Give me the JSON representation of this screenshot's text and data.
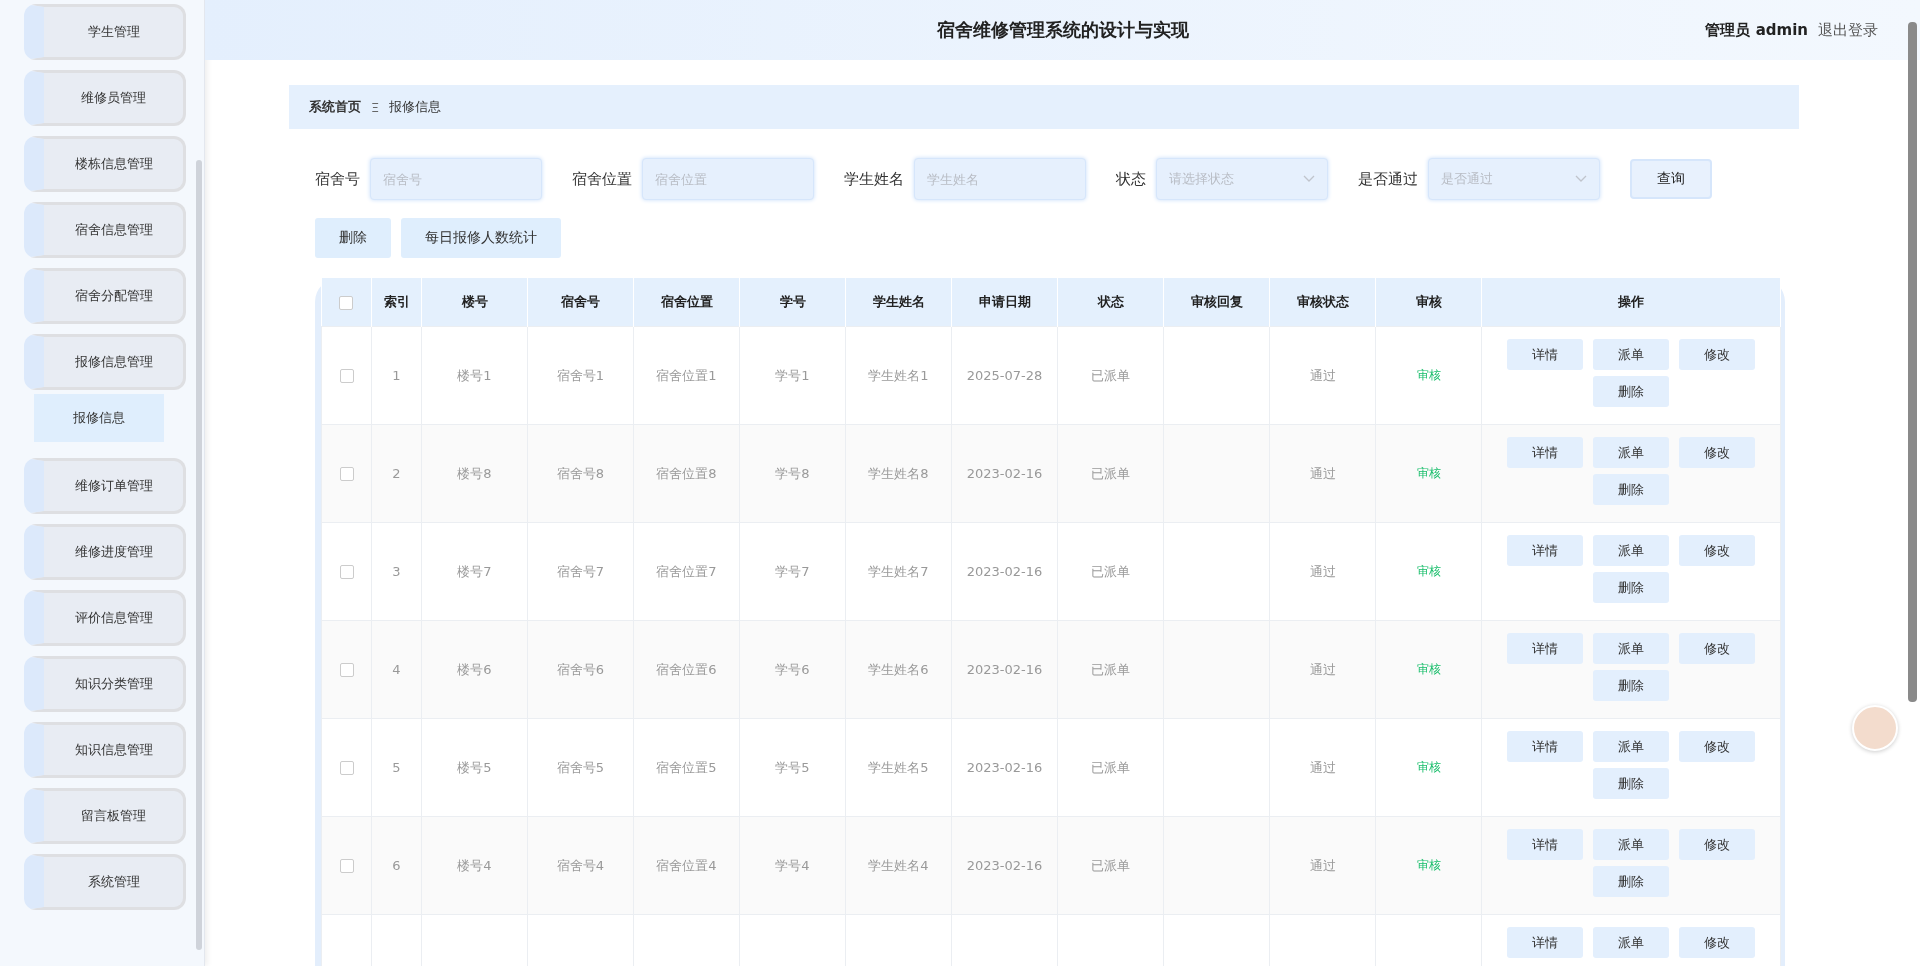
{
  "header": {
    "title": "宿舍维修管理系统的设计与实现",
    "user": "管理员 admin",
    "logout": "退出登录"
  },
  "sidebar": {
    "items": [
      {
        "label": "学生管理",
        "selected": false
      },
      {
        "label": "维修员管理",
        "selected": false
      },
      {
        "label": "楼栋信息管理",
        "selected": false
      },
      {
        "label": "宿舍信息管理",
        "selected": false
      },
      {
        "label": "宿舍分配管理",
        "selected": false
      },
      {
        "label": "报修信息管理",
        "selected": false,
        "expanded": true,
        "children": [
          {
            "label": "报修信息",
            "selected": true
          }
        ]
      },
      {
        "label": "维修订单管理",
        "selected": false
      },
      {
        "label": "维修进度管理",
        "selected": false
      },
      {
        "label": "评价信息管理",
        "selected": false
      },
      {
        "label": "知识分类管理",
        "selected": false
      },
      {
        "label": "知识信息管理",
        "selected": false
      },
      {
        "label": "留言板管理",
        "selected": false
      },
      {
        "label": "系统管理",
        "selected": false
      }
    ]
  },
  "breadcrumb": {
    "home": "系统首页",
    "separator": "Ξ",
    "current": "报修信息"
  },
  "filters": [
    {
      "kind": "input",
      "label": "宿舍号",
      "placeholder": "宿舍号"
    },
    {
      "kind": "input",
      "label": "宿舍位置",
      "placeholder": "宿舍位置"
    },
    {
      "kind": "input",
      "label": "学生姓名",
      "placeholder": "学生姓名"
    },
    {
      "kind": "select",
      "label": "状态",
      "placeholder": "请选择状态"
    },
    {
      "kind": "select",
      "label": "是否通过",
      "placeholder": "是否通过"
    }
  ],
  "query_button": "查询",
  "toolbar": [
    "删除",
    "每日报修人数统计"
  ],
  "table": {
    "all_checked": false,
    "columns": [
      "索引",
      "楼号",
      "宿舍号",
      "宿舍位置",
      "学号",
      "学生姓名",
      "申请日期",
      "状态",
      "审核回复",
      "审核状态",
      "审核",
      "操作"
    ],
    "rows": [
      {
        "checked": false,
        "cells": [
          "1",
          "楼号1",
          "宿舍号1",
          "宿舍位置1",
          "学号1",
          "学生姓名1",
          "2025-07-28",
          "已派单",
          "",
          "通过"
        ],
        "review": "审核",
        "actions": [
          "详情",
          "派单",
          "修改",
          "删除"
        ]
      },
      {
        "checked": false,
        "cells": [
          "2",
          "楼号8",
          "宿舍号8",
          "宿舍位置8",
          "学号8",
          "学生姓名8",
          "2023-02-16",
          "已派单",
          "",
          "通过"
        ],
        "review": "审核",
        "actions": [
          "详情",
          "派单",
          "修改",
          "删除"
        ]
      },
      {
        "checked": false,
        "cells": [
          "3",
          "楼号7",
          "宿舍号7",
          "宿舍位置7",
          "学号7",
          "学生姓名7",
          "2023-02-16",
          "已派单",
          "",
          "通过"
        ],
        "review": "审核",
        "actions": [
          "详情",
          "派单",
          "修改",
          "删除"
        ]
      },
      {
        "checked": false,
        "cells": [
          "4",
          "楼号6",
          "宿舍号6",
          "宿舍位置6",
          "学号6",
          "学生姓名6",
          "2023-02-16",
          "已派单",
          "",
          "通过"
        ],
        "review": "审核",
        "actions": [
          "详情",
          "派单",
          "修改",
          "删除"
        ]
      },
      {
        "checked": false,
        "cells": [
          "5",
          "楼号5",
          "宿舍号5",
          "宿舍位置5",
          "学号5",
          "学生姓名5",
          "2023-02-16",
          "已派单",
          "",
          "通过"
        ],
        "review": "审核",
        "actions": [
          "详情",
          "派单",
          "修改",
          "删除"
        ]
      },
      {
        "checked": false,
        "cells": [
          "6",
          "楼号4",
          "宿舍号4",
          "宿舍位置4",
          "学号4",
          "学生姓名4",
          "2023-02-16",
          "已派单",
          "",
          "通过"
        ],
        "review": "审核",
        "actions": [
          "详情",
          "派单",
          "修改",
          "删除"
        ]
      },
      {
        "actions": [
          "详情",
          "派单",
          "修改"
        ]
      }
    ]
  }
}
